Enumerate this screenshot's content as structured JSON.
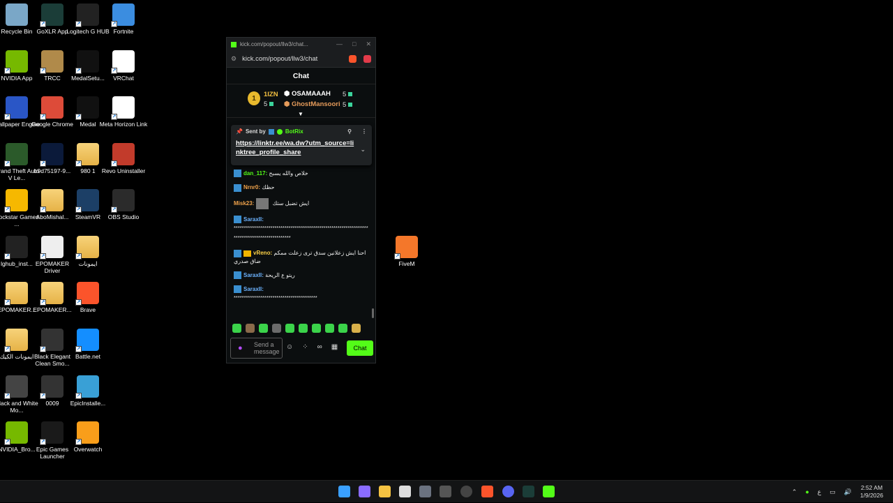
{
  "desktop": {
    "icons": [
      {
        "label": "Recycle Bin",
        "color": "#7aa7c7"
      },
      {
        "label": "GoXLR App",
        "color": "#1b3d38"
      },
      {
        "label": "Logitech G HUB",
        "color": "#222222"
      },
      {
        "label": "Fortnite",
        "color": "#3b8de0"
      },
      {
        "label": "NVIDIA App",
        "color": "#76b900"
      },
      {
        "label": "TRCC",
        "color": "#b08a4a"
      },
      {
        "label": "MedalSetu...",
        "color": "#111111"
      },
      {
        "label": "VRChat",
        "color": "#ffffff"
      },
      {
        "label": "Wallpaper Engine",
        "color": "#2a56c6"
      },
      {
        "label": "Google Chrome",
        "color": "#dd4b39"
      },
      {
        "label": "Medal",
        "color": "#111111"
      },
      {
        "label": "Meta Horizon Link",
        "color": "#ffffff"
      },
      {
        "label": "Grand Theft Auto V Le...",
        "color": "#2b5a2a"
      },
      {
        "label": "b9d75197-9...",
        "color": "#0b1a3a"
      },
      {
        "label": "980 1",
        "color": "#e7bd5c"
      },
      {
        "label": "Revo Uninstaller",
        "color": "#c23b2b"
      },
      {
        "label": "Rockstar Games ...",
        "color": "#f6b800"
      },
      {
        "label": "AboMishal...",
        "color": "#e7bd5c"
      },
      {
        "label": "SteamVR",
        "color": "#1c3f66"
      },
      {
        "label": "OBS Studio",
        "color": "#2b2b2b"
      },
      {
        "label": "lghub_inst...",
        "color": "#222222"
      },
      {
        "label": "EPOMAKER Driver",
        "color": "#eeeeee"
      },
      {
        "label": "ايمونات",
        "color": "#c0392b"
      },
      {
        "label": "EPOMAKER...",
        "color": "#e7bd5c"
      },
      {
        "label": "EPOMAKER...",
        "color": "#e7bd5c"
      },
      {
        "label": "Brave",
        "color": "#fb542b"
      },
      {
        "label": "ايمونات الكيك",
        "color": "#c0392b"
      },
      {
        "label": "Black Elegant Clean Smo...",
        "color": "#333333"
      },
      {
        "label": "Battle.net",
        "color": "#148eff"
      },
      {
        "label": "Black and White Mo...",
        "color": "#444444"
      },
      {
        "label": "0009",
        "color": "#333333"
      },
      {
        "label": "EpicInstalle...",
        "color": "#39a0d6"
      },
      {
        "label": "NVIDIA_Bro...",
        "color": "#76b900"
      },
      {
        "label": "Epic Games Launcher",
        "color": "#1a1a1a"
      },
      {
        "label": "Overwatch",
        "color": "#f99e1a"
      },
      {
        "label": "FiveM",
        "color": "#f4772a"
      }
    ]
  },
  "window": {
    "title": "kick.com/popout/llw3/chat...",
    "url": "kick.com/popout/llw3/chat",
    "header": "Chat",
    "leaderboard": {
      "rank1_name": "1IZN",
      "rank1_count": "5",
      "rank1_medal": "1",
      "rank2_name": "OSAMAAAH",
      "rank2_count": "5",
      "rank3_name": "GhostMansoori",
      "rank3_count": "5"
    },
    "pinned": {
      "sent_by": "Sent by",
      "bot_name": "BotRix",
      "link_text": "https://linktr.ee/wa.dw?utm_source=linktree_profile_share"
    },
    "messages": [
      {
        "user": "dan_117:",
        "text": "خلاص والله يسبح"
      },
      {
        "user": "Nrnr0:",
        "text": "حظك"
      },
      {
        "user": "Misk23:",
        "text": "ايش تضبل ستك"
      },
      {
        "user": "SaraxII:",
        "text": "**********************************************************************************************"
      },
      {
        "user": "vReno:",
        "text": "احنا ايش زعلانين سدق ترى زعلت ممكم ضاق صدري"
      },
      {
        "user": "SaraxII:",
        "text": "ريتو ع الريحة"
      },
      {
        "user": "SaraxII:",
        "text": "*****************************************"
      }
    ],
    "input_placeholder": "Send a message",
    "chat_button": "Chat"
  },
  "taskbar": {
    "time": "2:52 AM",
    "date": "1/9/2026",
    "lang": "ع"
  }
}
